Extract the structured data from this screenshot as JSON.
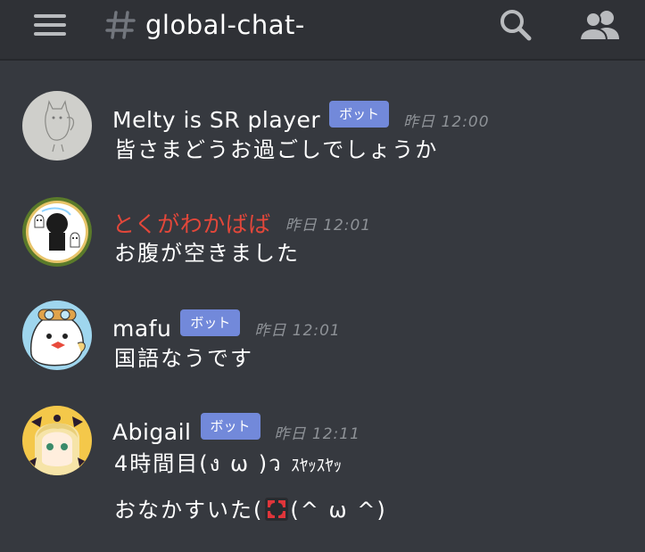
{
  "header": {
    "channel_name": "global-chat-"
  },
  "messages": [
    {
      "username": "Melty is SR player",
      "bot_badge": "ボット",
      "timestamp": "昨日 12:00",
      "lines": [
        "皆さまどうお過ごしでしょうか"
      ]
    },
    {
      "username": "とくがわかばば",
      "timestamp": "昨日 12:01",
      "lines": [
        "お腹が空きました"
      ]
    },
    {
      "username": "mafu",
      "bot_badge": "ボット",
      "timestamp": "昨日 12:01",
      "lines": [
        "国語なうです"
      ]
    },
    {
      "username": "Abigail",
      "bot_badge": "ボット",
      "timestamp": "昨日 12:11",
      "line1_main": "4時間目(ง ω )ว",
      "line1_small": "ｽﾔｯｽﾔｯ",
      "line2_start": "おなかすいた(",
      "line2_end": "(^ ω ^)"
    }
  ],
  "colors": {
    "background": "#36393f",
    "header_bg": "#2f3136",
    "bot_badge": "#7289da",
    "username_red": "#e2473a",
    "timestamp": "#8e9297"
  },
  "icons": [
    "hamburger-menu-icon",
    "channel-hash-icon",
    "search-icon",
    "members-icon",
    "anger-symbol-emoji"
  ]
}
